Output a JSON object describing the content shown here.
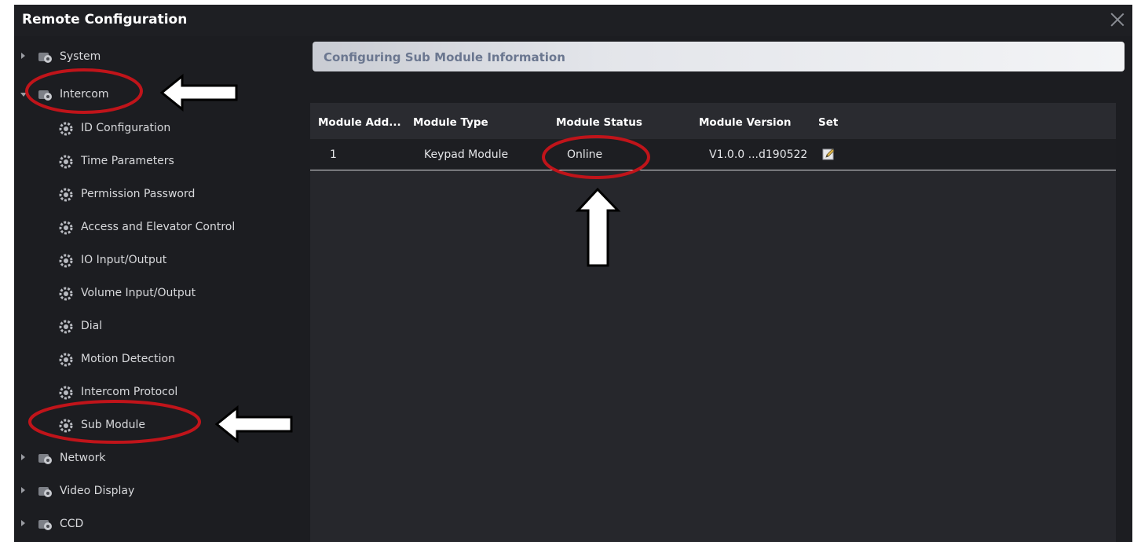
{
  "window": {
    "title": "Remote Configuration"
  },
  "sidebar": {
    "groups": [
      {
        "label": "System",
        "expanded": false
      },
      {
        "label": "Intercom",
        "expanded": true
      },
      {
        "label": "Network",
        "expanded": false
      },
      {
        "label": "Video Display",
        "expanded": false
      },
      {
        "label": "CCD",
        "expanded": false
      }
    ],
    "intercom_items": [
      {
        "label": "ID Configuration"
      },
      {
        "label": "Time Parameters"
      },
      {
        "label": "Permission Password"
      },
      {
        "label": "Access and Elevator Control"
      },
      {
        "label": "IO Input/Output"
      },
      {
        "label": "Volume Input/Output"
      },
      {
        "label": "Dial"
      },
      {
        "label": "Motion Detection"
      },
      {
        "label": "Intercom Protocol"
      },
      {
        "label": "Sub Module",
        "selected": true
      }
    ]
  },
  "main": {
    "header_title": "Configuring Sub Module Information",
    "table": {
      "columns": [
        "Module Add...",
        "Module Type",
        "Module Status",
        "Module Version",
        "Set"
      ],
      "rows": [
        {
          "address": "1",
          "type": "Keypad Module",
          "status": "Online",
          "version": "V1.0.0 ...d190522",
          "set_icon": "edit-icon"
        }
      ]
    }
  },
  "colors": {
    "background": "#1c1d21",
    "highlight_ellipse": "#c0141a",
    "arrow_fill": "#ffffff"
  }
}
